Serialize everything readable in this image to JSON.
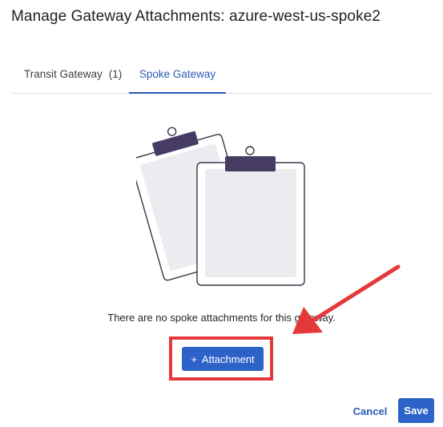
{
  "dialog": {
    "title": "Manage Gateway Attachments: azure-west-us-spoke2"
  },
  "tabs": [
    {
      "label": "Transit Gateway",
      "count": "(1)",
      "active": false
    },
    {
      "label": "Spoke Gateway",
      "active": true
    }
  ],
  "empty_state": {
    "illustration": "clipboard-icon",
    "message": "There are no spoke attachments for this gateway.",
    "add_button_label": "Attachment",
    "add_button_icon": "plus-icon"
  },
  "footer": {
    "cancel_label": "Cancel",
    "save_label": "Save"
  },
  "colors": {
    "accent": "#2d63c8",
    "annotation": "#e5383b",
    "clip": "#463c63"
  }
}
